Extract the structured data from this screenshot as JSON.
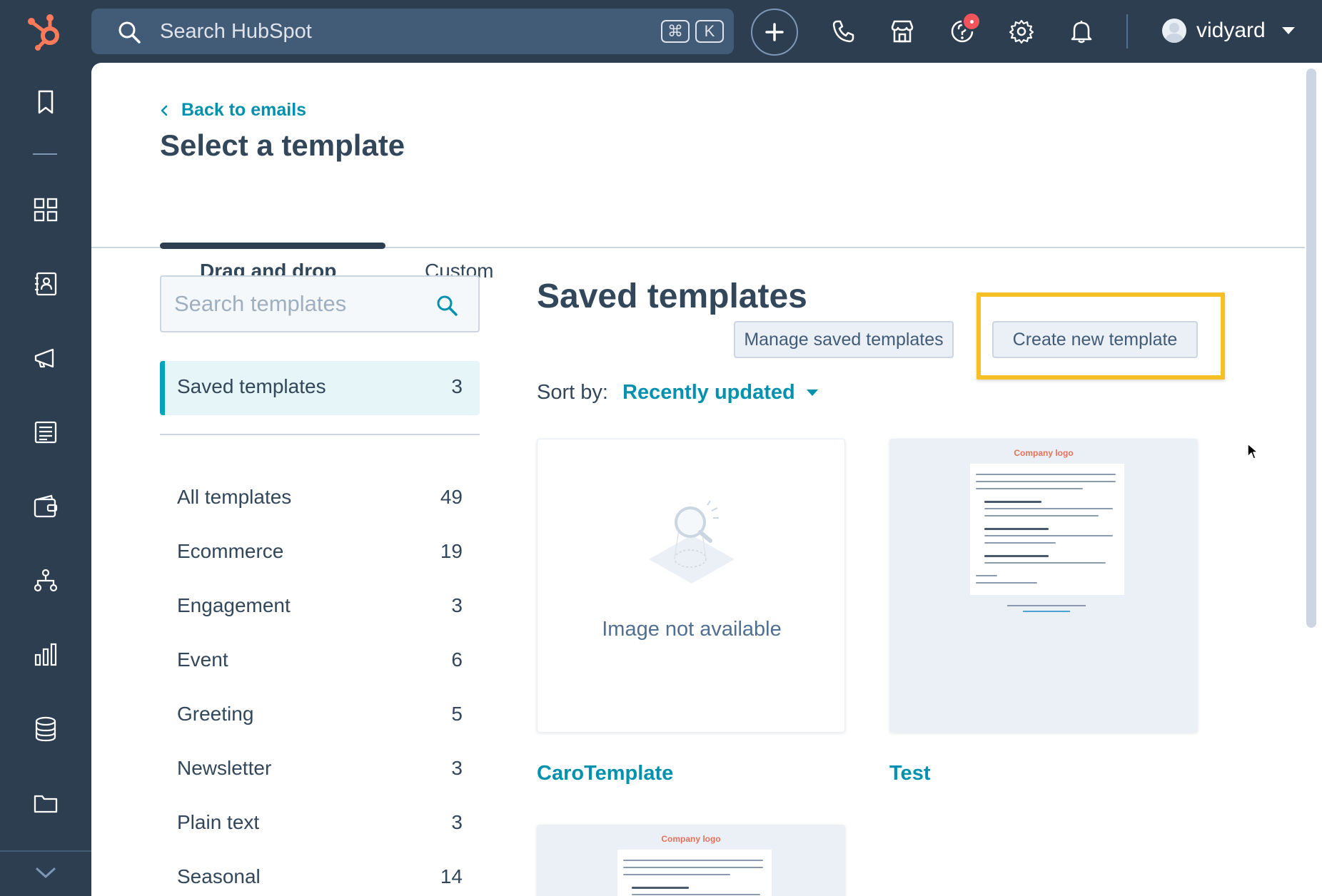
{
  "topbar": {
    "search_placeholder": "Search HubSpot",
    "shortcut_cmd": "⌘",
    "shortcut_key": "K",
    "user_name": "vidyard"
  },
  "header": {
    "back_link": "Back to emails",
    "title": "Select a template"
  },
  "tabs": [
    {
      "label": "Drag and drop",
      "active": true
    },
    {
      "label": "Custom",
      "active": false
    }
  ],
  "filters": {
    "search_placeholder": "Search templates",
    "selected": {
      "label": "Saved templates",
      "count": "3"
    },
    "categories": [
      {
        "label": "All templates",
        "count": "49"
      },
      {
        "label": "Ecommerce",
        "count": "19"
      },
      {
        "label": "Engagement",
        "count": "3"
      },
      {
        "label": "Event",
        "count": "6"
      },
      {
        "label": "Greeting",
        "count": "5"
      },
      {
        "label": "Newsletter",
        "count": "3"
      },
      {
        "label": "Plain text",
        "count": "3"
      },
      {
        "label": "Seasonal",
        "count": "14"
      }
    ]
  },
  "content": {
    "section_title": "Saved templates",
    "manage_button": "Manage saved templates",
    "create_button": "Create new template",
    "sort_label": "Sort by:",
    "sort_value": "Recently updated",
    "image_not_available": "Image not available",
    "thumb_logo": "Company logo",
    "cards": [
      {
        "name": "CaroTemplate"
      },
      {
        "name": "Test"
      }
    ]
  },
  "colors": {
    "nav_bg": "#2d3e50",
    "accent": "#0091ae",
    "highlight": "#f5c026",
    "notification": "#f2545b"
  }
}
